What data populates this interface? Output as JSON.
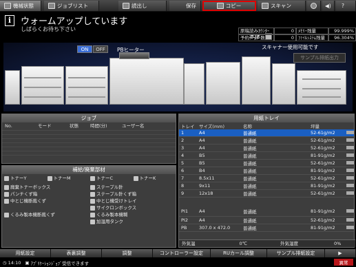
{
  "tabs": [
    {
      "label": "機械状態",
      "icon": "machine-icon"
    },
    {
      "label": "ジョブリスト",
      "icon": "job-list-icon"
    },
    {
      "label": "読出し",
      "icon": "recall-icon"
    },
    {
      "label": "保存",
      "icon": "save-icon"
    },
    {
      "label": "コピー",
      "icon": "copy-icon"
    },
    {
      "label": "スキャン",
      "icon": "scan-icon"
    }
  ],
  "header": {
    "title": "ウォームアップしています",
    "subtitle": "しばらくお待ち下さい",
    "body_label": "本体"
  },
  "counters": {
    "rows": [
      {
        "label": "原稿読みｶｳﾝﾀｰ",
        "value": "0",
        "label2": "ﾒﾓﾘｰ残量",
        "value2": "99.999%"
      },
      {
        "label": "予約ｼﾞｮﾌﾞ数",
        "value": "0",
        "label2": "ﾌｧｲﾙｼｽﾃﾑ残量",
        "value2": "96.304%"
      }
    ]
  },
  "scanner_message": "スキャナー使用可能です",
  "sample_button": "サンプル排紙出力",
  "heater": {
    "on_label": "ON",
    "off_label": "OFF",
    "label": "PBヒーター"
  },
  "jobs_panel": {
    "title": "ジョブ",
    "columns": [
      "No.",
      "モード",
      "状態",
      "時間(分)",
      "ユーザー名"
    ]
  },
  "supply_panel": {
    "title": "補給/廃棄部材",
    "items": [
      [
        "トナーY",
        "トナーM",
        "トナーC",
        "トナーK"
      ],
      [
        "廃棄トナーボックス",
        "ステープル針"
      ],
      [
        "パンチくず箱",
        "ステープル針くず箱"
      ],
      [
        "中とじ機断裁くず",
        "中とじ機受けトレイ"
      ],
      [
        "",
        "サイクロンボックス"
      ],
      [
        "くるみ製本機断裁くず",
        "くるみ製本機糊"
      ],
      [
        "",
        "加湿用タンク"
      ]
    ]
  },
  "paper_panel": {
    "title": "用紙トレイ",
    "columns": [
      "トレイ",
      "サイズ(mm)",
      "名称",
      "坪量"
    ],
    "rows": [
      {
        "tray": "1",
        "size": "A4",
        "name": "普通紙",
        "weight": "52-61g/m2"
      },
      {
        "tray": "2",
        "size": "A4",
        "name": "普通紙",
        "weight": "52-61g/m2"
      },
      {
        "tray": "3",
        "size": "A4",
        "name": "普通紙",
        "weight": "52-61g/m2"
      },
      {
        "tray": "4",
        "size": "B5",
        "name": "普通紙",
        "weight": "81-91g/m2"
      },
      {
        "tray": "5",
        "size": "B5",
        "name": "普通紙",
        "weight": "52-61g/m2"
      },
      {
        "tray": "6",
        "size": "B4",
        "name": "普通紙",
        "weight": "81-91g/m2"
      },
      {
        "tray": "7",
        "size": "8.5x11",
        "name": "普通紙",
        "weight": "52-61g/m2"
      },
      {
        "tray": "8",
        "size": "9x11",
        "name": "普通紙",
        "weight": "81-91g/m2"
      },
      {
        "tray": "9",
        "size": "12x18",
        "name": "普通紙",
        "weight": "52-61g/m2"
      },
      {
        "tray": "PI1",
        "size": "A4",
        "name": "普通紙",
        "weight": "81-91g/m2"
      },
      {
        "tray": "PI2",
        "size": "A4",
        "name": "普通紙",
        "weight": "52-61g/m2"
      },
      {
        "tray": "PB",
        "size": "307.0 x 472.0",
        "name": "普通紙",
        "weight": "81-91g/m2"
      }
    ],
    "outside_temp_label": "外気温",
    "outside_temp_value": "0℃",
    "outside_hum_label": "外気湿度",
    "outside_hum_value": "0%"
  },
  "bottom_buttons": [
    "用紙設定",
    "表裏調整",
    "調整",
    "コントローラー設定",
    "RUカール調整",
    "サンプル排紙設定"
  ],
  "status": {
    "time": "14:10",
    "message": "ｱﾌﾟﾘｹｰｼｮﾝｼﾞｮﾌﾞ受信できます",
    "error": "異常"
  },
  "colors": {
    "accent": "#1a5fc2",
    "alert": "#e00000",
    "heater_on": "#3a6ed8"
  }
}
